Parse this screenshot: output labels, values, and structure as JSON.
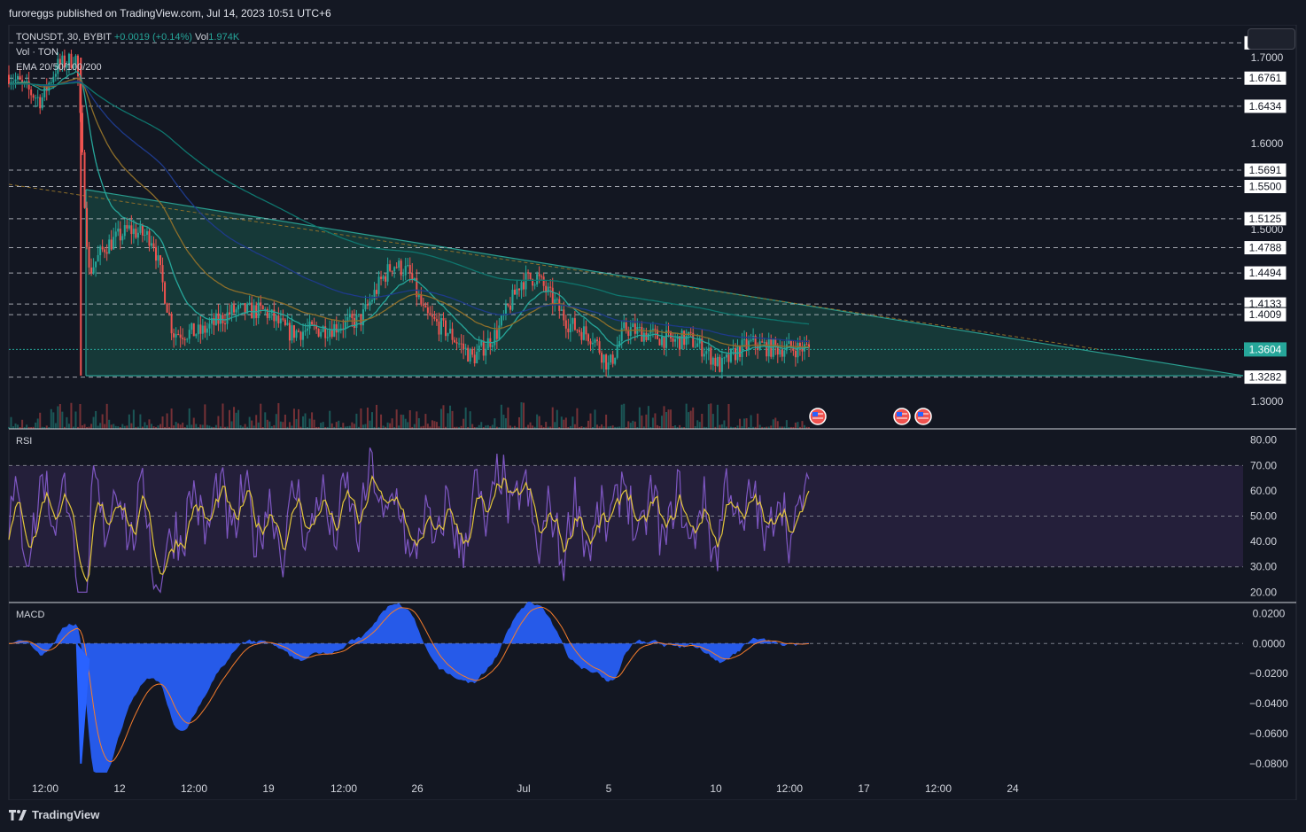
{
  "header": {
    "published": "furoreggs published on TradingView.com, Jul 14, 2023 10:51 UTC+6"
  },
  "legend": {
    "symbol": "TONUSDT, 30, BYBIT",
    "change": "+0.0019 (+0.14%)",
    "vol_label": "Vol",
    "vol_value": "1.974K",
    "vol_ton": "Vol · TON",
    "ema": "EMA 20/50/100/200"
  },
  "panes": {
    "rsi_label": "RSI",
    "macd_label": "MACD"
  },
  "footer": {
    "brand": "TradingView"
  },
  "colors": {
    "background": "#141823",
    "up": "#26a69a",
    "down": "#ef5350",
    "triangle_fill": "#17403c",
    "triangle_line": "#2a9d8f",
    "rsi_line": "#7e57c2",
    "rsi_ma": "#e2c53b",
    "rsi_band": "#241f3a",
    "macd_hist": "#2962ff",
    "macd_signal": "#f57c2c",
    "ema_20": "#26a69a",
    "ema_50": "#8d6e2a",
    "ema_100": "#1e3a8a",
    "ema_200": "#0f766e"
  },
  "icons": [
    "us-flag-event-icon",
    "us-flag-event-icon",
    "us-flag-event-icon",
    "tradingview-logo-icon"
  ],
  "chart_data": {
    "type": "candlestick",
    "symbol": "TONUSDT",
    "interval": "30",
    "exchange": "BYBIT",
    "price_axis": {
      "ticks": [
        "1.7000",
        "1.6000",
        "1.5000",
        "1.4000",
        "1.3000"
      ],
      "range": [
        1.268,
        1.732
      ],
      "level_labels": [
        "1.7172",
        "1.6761",
        "1.6434",
        "1.5691",
        "1.5500",
        "1.5125",
        "1.4788",
        "1.4494",
        "1.4133",
        "1.4009",
        "1.3282"
      ],
      "current_price": "1.3604"
    },
    "time_axis": {
      "labels": [
        "12:00",
        "12",
        "12:00",
        "19",
        "12:00",
        "26",
        "Jul",
        "5",
        "10",
        "12:00",
        "17",
        "12:00",
        "24"
      ]
    },
    "rsi": {
      "ticks": [
        "80.00",
        "70.00",
        "60.00",
        "50.00",
        "40.00",
        "30.00",
        "20.00"
      ],
      "range": [
        18,
        82
      ],
      "band": [
        30,
        70
      ]
    },
    "macd": {
      "ticks": [
        "0.0200",
        "0.0000",
        "−0.0200",
        "−0.0400",
        "−0.0600",
        "−0.0800"
      ],
      "range": [
        -0.086,
        0.022
      ]
    },
    "key_points": [
      [
        0.0,
        1.68
      ],
      [
        0.04,
        1.65
      ],
      [
        0.06,
        1.69
      ],
      [
        0.085,
        1.7
      ],
      [
        0.09,
        1.612
      ],
      [
        0.1,
        1.45
      ],
      [
        0.12,
        1.48
      ],
      [
        0.15,
        1.5
      ],
      [
        0.18,
        1.49
      ],
      [
        0.205,
        1.38
      ],
      [
        0.24,
        1.38
      ],
      [
        0.28,
        1.405
      ],
      [
        0.32,
        1.405
      ],
      [
        0.35,
        1.38
      ],
      [
        0.4,
        1.385
      ],
      [
        0.44,
        1.395
      ],
      [
        0.465,
        1.44
      ],
      [
        0.48,
        1.46
      ],
      [
        0.5,
        1.45
      ],
      [
        0.52,
        1.4
      ],
      [
        0.55,
        1.38
      ],
      [
        0.58,
        1.35
      ],
      [
        0.61,
        1.38
      ],
      [
        0.64,
        1.44
      ],
      [
        0.66,
        1.445
      ],
      [
        0.7,
        1.39
      ],
      [
        0.73,
        1.375
      ],
      [
        0.75,
        1.34
      ],
      [
        0.77,
        1.385
      ],
      [
        0.8,
        1.378
      ],
      [
        0.83,
        1.37
      ],
      [
        0.85,
        1.373
      ],
      [
        0.87,
        1.36
      ],
      [
        0.89,
        1.34
      ],
      [
        0.912,
        1.36
      ],
      [
        0.93,
        1.368
      ],
      [
        0.95,
        1.362
      ],
      [
        1.0,
        1.362
      ]
    ]
  }
}
